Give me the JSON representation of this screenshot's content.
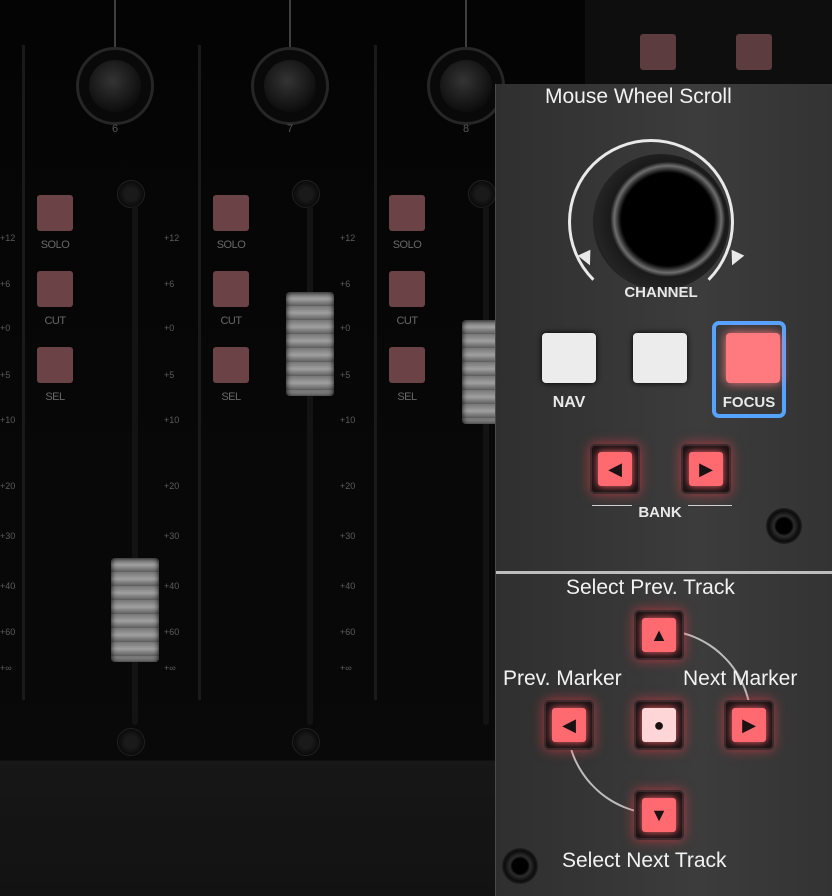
{
  "mixer": {
    "channels": [
      {
        "number": "6",
        "solo": "SOLO",
        "cut": "CUT",
        "sel": "SEL"
      },
      {
        "number": "7",
        "solo": "SOLO",
        "cut": "CUT",
        "sel": "SEL"
      },
      {
        "number": "8",
        "solo": "SOLO",
        "cut": "CUT",
        "sel": "SEL"
      }
    ],
    "scale": [
      "+12",
      "+6",
      "+0",
      "+5",
      "+10",
      "+20",
      "+30",
      "+40",
      "+60",
      "+∞"
    ]
  },
  "panel": {
    "mouse_wheel_label": "Mouse Wheel Scroll",
    "channel_label": "CHANNEL",
    "nav_label": "NAV",
    "focus_label": "FOCUS",
    "bank_label": "BANK",
    "select_prev_track": "Select Prev. Track",
    "prev_marker": "Prev. Marker",
    "next_marker": "Next Marker",
    "select_next_track": "Select Next Track"
  },
  "icons": {
    "bank_left": "triangle-left-icon",
    "bank_right": "triangle-right-icon",
    "up": "triangle-up-icon",
    "down": "triangle-down-icon",
    "left": "triangle-left-icon",
    "right": "triangle-right-icon",
    "center": "dot-icon"
  },
  "colors": {
    "focus_outline": "#56a3ff",
    "focus_button": "#ff7a7e",
    "red_led": "#ff6a70"
  }
}
